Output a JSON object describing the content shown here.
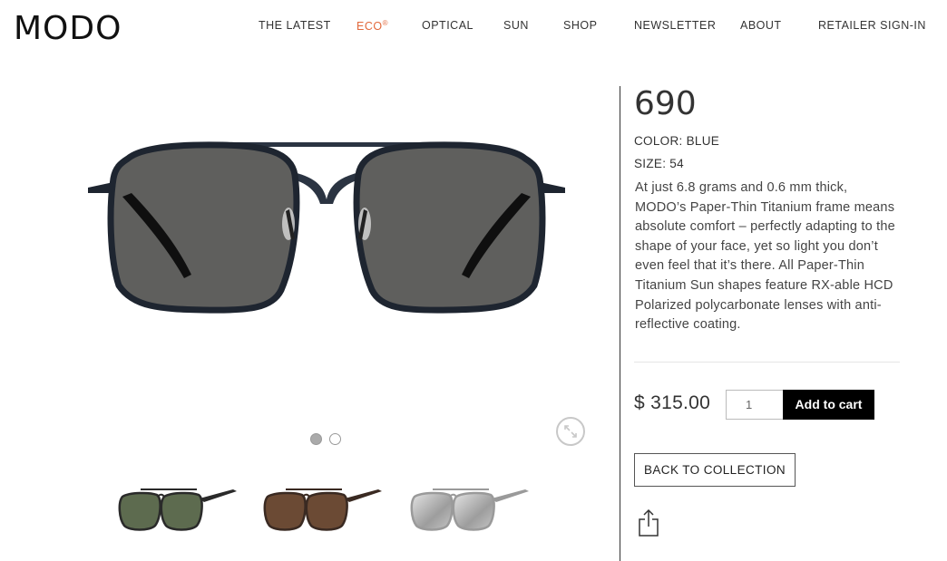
{
  "header": {
    "logo": "MODO",
    "nav": [
      {
        "label": "THE LATEST"
      },
      {
        "label": "ECO",
        "mark": "®"
      },
      {
        "label": "OPTICAL"
      },
      {
        "label": "SUN"
      },
      {
        "label": "SHOP"
      },
      {
        "label": "NEWSLETTER"
      },
      {
        "label": "ABOUT"
      },
      {
        "label": "RETAILER SIGN-IN"
      }
    ]
  },
  "colors": {
    "accent": "#e2683b",
    "frame": "#1e2530",
    "lens": "#5f5f5d",
    "cart_button": "#000000"
  },
  "gallery": {
    "main_icon": "sunglasses-main-image",
    "zoom_icon": "zoom-icon",
    "dots_count": 2,
    "active_dot": 0,
    "thumbnails": [
      {
        "name": "green-lens-variant",
        "lens": "#5d6b4f",
        "frame": "#2a2a2a"
      },
      {
        "name": "brown-lens-variant",
        "lens": "#6b4a34",
        "frame": "#3a2a22"
      },
      {
        "name": "silver-mirror-variant",
        "lens": "#b8b8b8",
        "frame": "#9a9a9a"
      }
    ]
  },
  "product": {
    "title": "690",
    "color_line": "COLOR: BLUE",
    "size_line": "SIZE: 54",
    "description": "At just 6.8 grams and 0.6 mm thick, MODO’s Paper-Thin Titanium frame means absolute comfort – perfectly adapting to the shape of your face, yet so light you don’t even feel that it’s there. All Paper-Thin Titanium Sun shapes feature RX-able HCD Polarized polycarbonate lenses with anti-reflective coating.",
    "price": "$ 315.00",
    "quantity": "1",
    "add_to_cart": "Add to cart",
    "back_to_collection": "BACK TO COLLECTION",
    "share_icon": "share-icon"
  }
}
